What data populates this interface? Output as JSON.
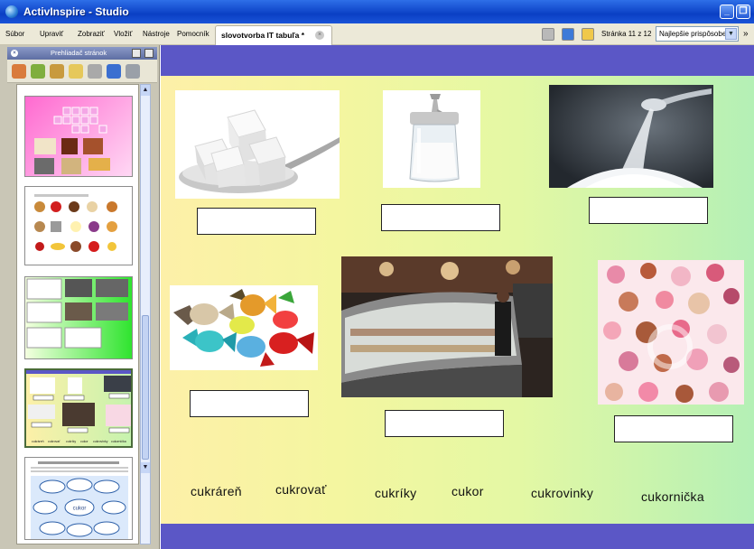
{
  "window": {
    "title": "ActivInspire - Studio"
  },
  "menu": {
    "items": [
      "Súbor",
      "Upraviť",
      "Zobraziť",
      "Vložiť",
      "Nástroje",
      "Pomocník"
    ]
  },
  "document_tab": {
    "title": "slovotvorba IT tabuľa *"
  },
  "page_info": "Stránka 11 z 12",
  "zoom": {
    "selected": "Najlepšie prispôsobenie"
  },
  "browser": {
    "title": "Prehliadač stránok"
  },
  "thumb4_words": [
    "cukráreň",
    "cukrovať",
    "cukríky",
    "cukor",
    "cukrovinky",
    "cukornička"
  ],
  "thumb5": {
    "center_word": "cukor"
  },
  "words": [
    "cukráreň",
    "cukrovať",
    "cukríky",
    "cukor",
    "cukrovinky",
    "cukornička"
  ],
  "colors": {
    "canvas_band": "#5b57c6",
    "titlebar": "#0a3fc4"
  }
}
